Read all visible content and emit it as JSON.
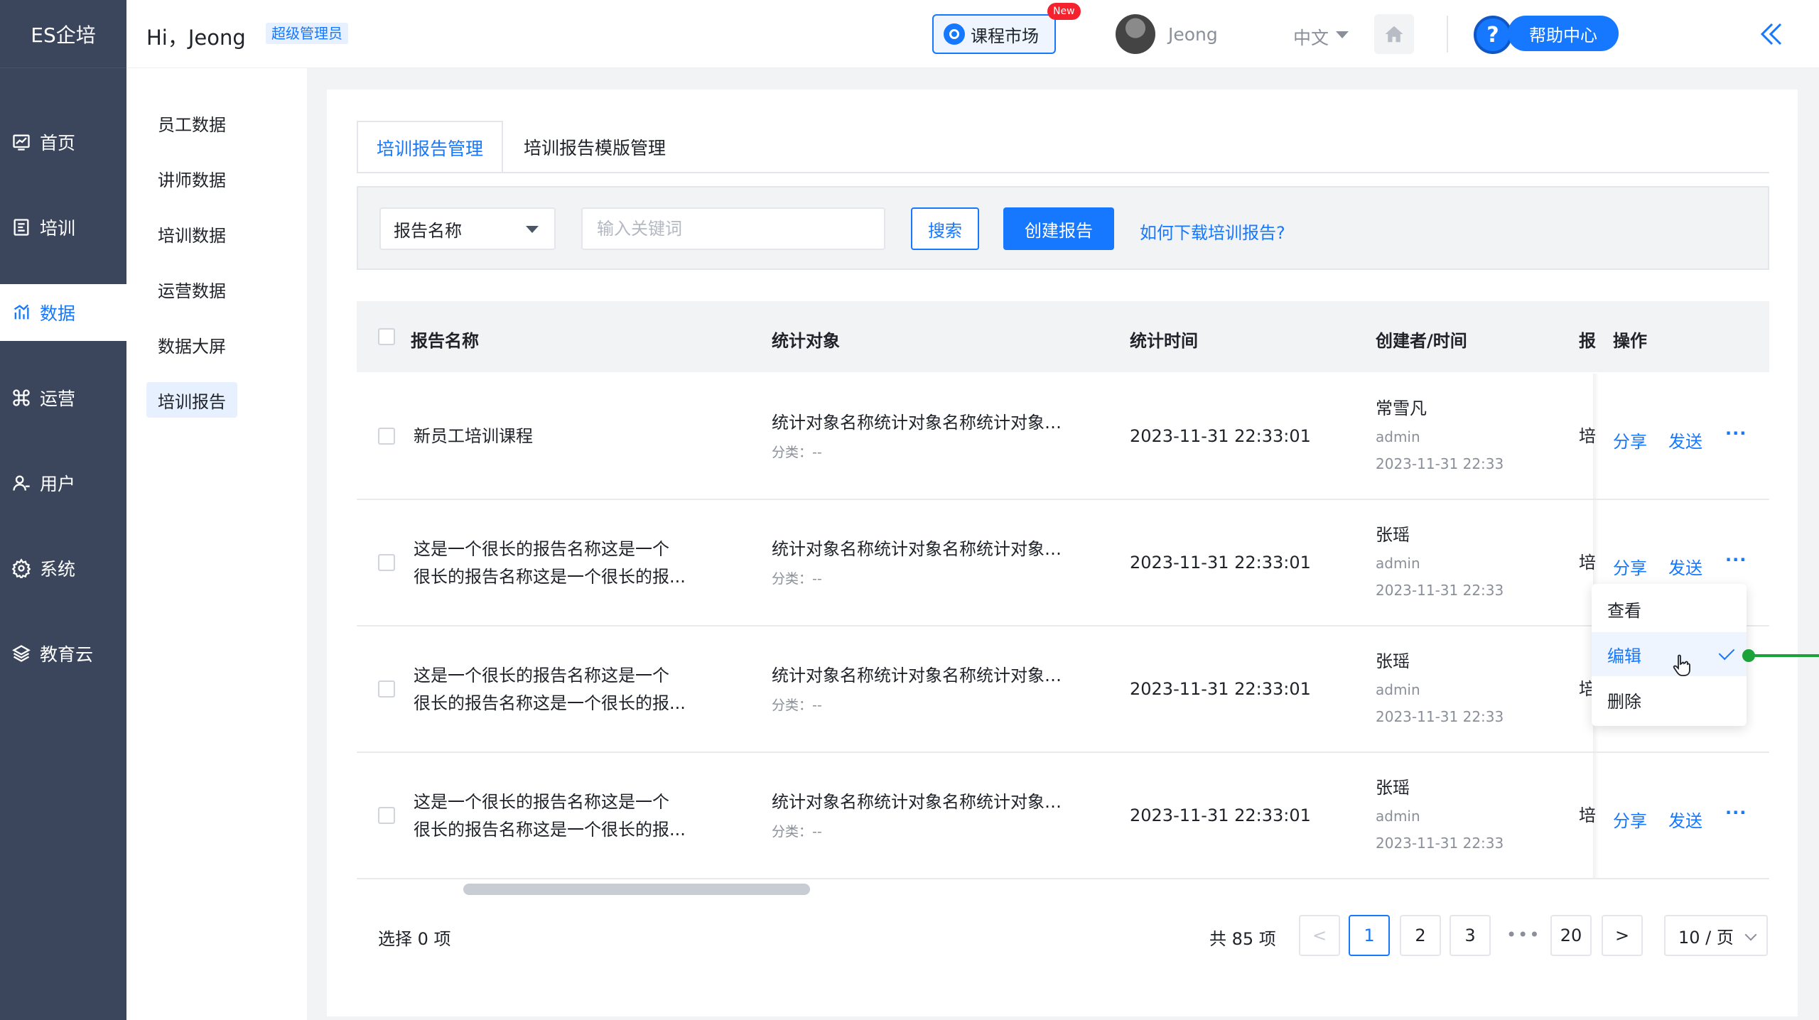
{
  "nav": {
    "logo": "ES企培",
    "items": [
      {
        "label": "首页",
        "icon": "dashboard-icon"
      },
      {
        "label": "培训",
        "icon": "training-icon"
      },
      {
        "label": "数据",
        "icon": "chart-icon",
        "active": true
      },
      {
        "label": "运营",
        "icon": "command-icon"
      },
      {
        "label": "用户",
        "icon": "user-icon"
      },
      {
        "label": "系统",
        "icon": "gear-icon"
      },
      {
        "label": "教育云",
        "icon": "cloud-icon"
      }
    ]
  },
  "topbar": {
    "greeting": "Hi，Jeong",
    "role_badge": "超级管理员",
    "market_label": "课程市场",
    "new_badge": "New",
    "username": "Jeong",
    "language": "中文",
    "help_label": "帮助中心",
    "help_icon_text": "?"
  },
  "subnav": {
    "items": [
      {
        "label": "员工数据"
      },
      {
        "label": "讲师数据"
      },
      {
        "label": "培训数据",
        "expandable": true
      },
      {
        "label": "运营数据",
        "expandable": true
      },
      {
        "label": "数据大屏"
      },
      {
        "label": "培训报告",
        "active": true
      }
    ]
  },
  "tabs": [
    {
      "label": "培训报告管理",
      "active": true
    },
    {
      "label": "培训报告模版管理"
    }
  ],
  "filter": {
    "select_value": "报告名称",
    "search_placeholder": "输入关键词",
    "search_button": "搜索",
    "create_button": "创建报告",
    "help_link": "如何下载培训报告?"
  },
  "table": {
    "headers": {
      "name": "报告名称",
      "target": "统计对象",
      "time": "统计时间",
      "creator": "创建者/时间",
      "clip": "报",
      "ops": "操作"
    },
    "rows": [
      {
        "name_line1": "新员工培训课程",
        "name_line2": "",
        "target": "统计对象名称统计对象名称统计对象名称",
        "category": "分类：--",
        "time": "2023-11-31 22:33:01",
        "creator": "常雪凡",
        "role": "admin",
        "created": "2023-11-31 22:33",
        "clip": "培"
      },
      {
        "name_line1": "这是一个很长的报告名称这是一个",
        "name_line2": "很长的报告名称这是一个很长的报...",
        "target": "统计对象名称统计对象名称统计对象名称",
        "category": "分类：--",
        "time": "2023-11-31 22:33:01",
        "creator": "张瑶",
        "role": "admin",
        "created": "2023-11-31 22:33",
        "clip": "培"
      },
      {
        "name_line1": "这是一个很长的报告名称这是一个",
        "name_line2": "很长的报告名称这是一个很长的报...",
        "target": "统计对象名称统计对象名称统计对象名称",
        "category": "分类：--",
        "time": "2023-11-31 22:33:01",
        "creator": "张瑶",
        "role": "admin",
        "created": "2023-11-31 22:33",
        "clip": "培"
      },
      {
        "name_line1": "这是一个很长的报告名称这是一个",
        "name_line2": "很长的报告名称这是一个很长的报...",
        "target": "统计对象名称统计对象名称统计对象名称",
        "category": "分类：--",
        "time": "2023-11-31 22:33:01",
        "creator": "张瑶",
        "role": "admin",
        "created": "2023-11-31 22:33",
        "clip": "培"
      }
    ],
    "ops": {
      "share": "分享",
      "send": "发送",
      "more": "···"
    }
  },
  "dropdown": {
    "items": [
      "查看",
      "编辑",
      "删除"
    ],
    "selected": "编辑"
  },
  "footer": {
    "selected_text": "选择 0 项",
    "total_text": "共 85 项",
    "prev": "<",
    "next": ">",
    "pages": [
      "1",
      "2",
      "3"
    ],
    "ellipsis": "•••",
    "last_page": "20",
    "current_page": "1",
    "page_size": "10 / 页"
  },
  "colors": {
    "primary": "#1677ff",
    "nav_bg": "#3b465c",
    "accent_green": "#1aa33a",
    "new_red": "#f5222d"
  }
}
